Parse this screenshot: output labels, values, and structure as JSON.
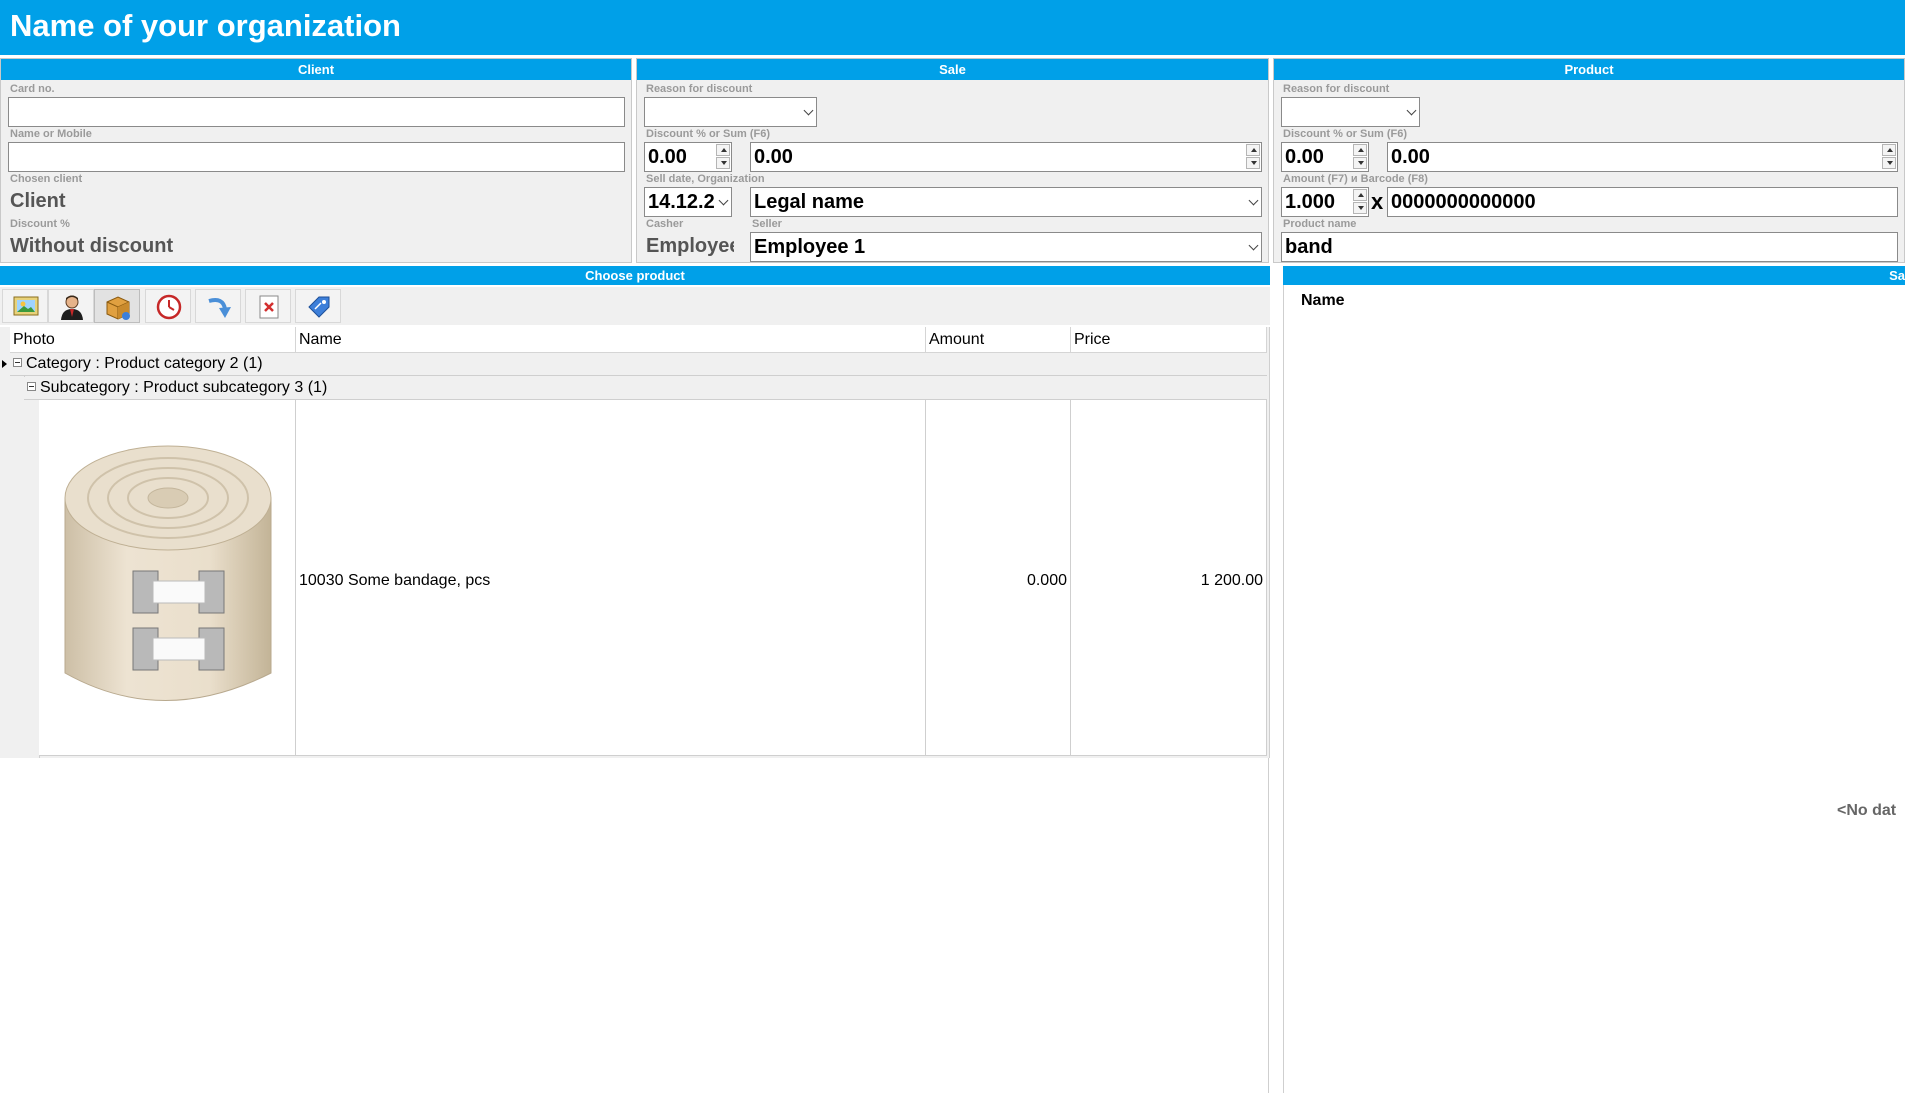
{
  "app": {
    "org_title": "Name of your organization"
  },
  "client": {
    "header": "Client",
    "card_label": "Card no.",
    "card_value": "",
    "name_label": "Name or Mobile",
    "name_value": "",
    "chosen_label": "Chosen client",
    "chosen_value": "Client",
    "discount_label": "Discount %",
    "discount_value": "Without discount"
  },
  "sale": {
    "header": "Sale",
    "reason_label": "Reason for discount",
    "reason_value": "",
    "discount_label": "Discount % or Sum (F6)",
    "discount_pct": "0.00",
    "discount_sum": "0.00",
    "date_label": "Sell date, Organization",
    "date_value": "14.12.2",
    "organization_value": "Legal name",
    "casher_label": "Casher",
    "casher_value": "Employee",
    "seller_label": "Seller",
    "seller_value": "Employee 1"
  },
  "product": {
    "header": "Product",
    "reason_label": "Reason for discount",
    "reason_value": "",
    "discount_label": "Discount % or Sum (F6)",
    "discount_pct": "0.00",
    "discount_sum": "0.00",
    "amount_label": "Amount (F7) и Barcode (F8)",
    "amount_value": "1.000",
    "times": "x",
    "barcode_value": "0000000000000",
    "name_label": "Product name",
    "name_value": "band"
  },
  "choose": {
    "header": "Choose product",
    "toolbar": [
      "photo-icon",
      "customer-icon",
      "product-box-icon",
      "clock-icon",
      "redo-arrow-icon",
      "delete-icon",
      "price-tag-icon"
    ],
    "columns": [
      "Photo",
      "Name",
      "Amount",
      "Price"
    ],
    "group": "Category : Product category 2 (1)",
    "subgroup": "Subcategory : Product subcategory 3 (1)",
    "rows": [
      {
        "name": "10030 Some bandage, pcs",
        "amount": "0.000",
        "price": "1 200.00"
      }
    ]
  },
  "sale_panel": {
    "header": "Sa",
    "col_name": "Name",
    "empty": "<No dat"
  },
  "colors": {
    "accent": "#00a0e8",
    "panel": "#f0f0f0"
  }
}
